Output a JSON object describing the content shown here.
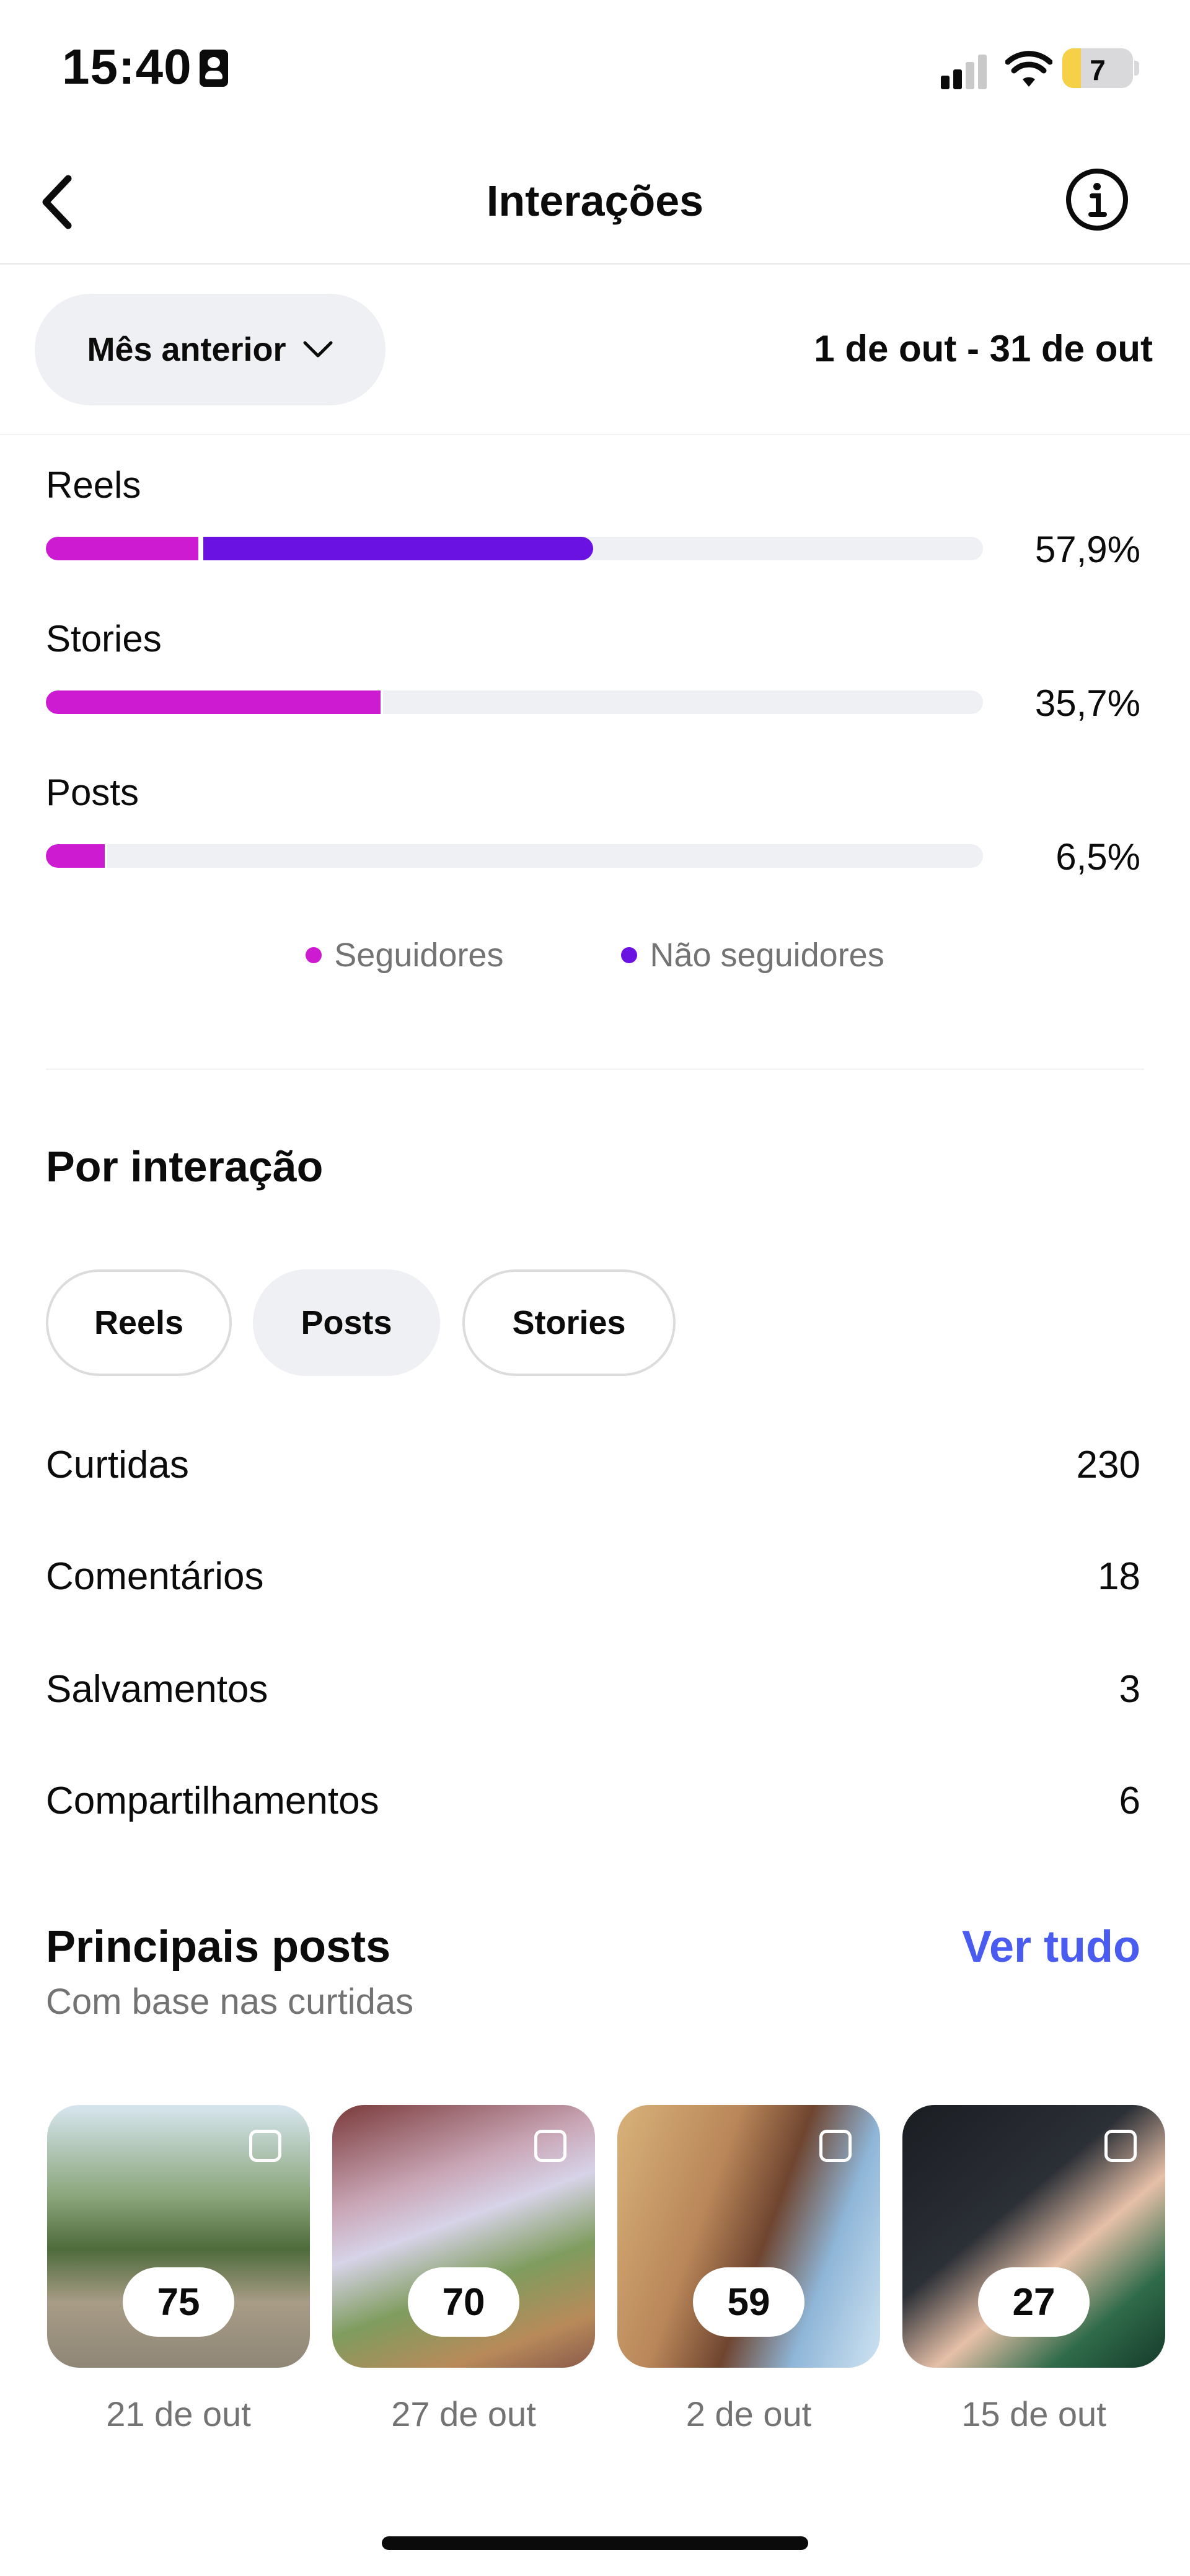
{
  "status_bar": {
    "time": "15:40",
    "battery": "7"
  },
  "header": {
    "title": "Interações"
  },
  "period": {
    "selected": "Mês anterior",
    "range": "1 de out - 31 de out"
  },
  "content_type_breakdown": [
    {
      "label": "Reels",
      "percent_text": "57,9%",
      "followers_fraction": 0.163,
      "non_followers_fraction": 0.416
    },
    {
      "label": "Stories",
      "percent_text": "35,7%",
      "followers_fraction": 0.357,
      "non_followers_fraction": 0.0
    },
    {
      "label": "Posts",
      "percent_text": "6,5%",
      "followers_fraction": 0.063,
      "non_followers_fraction": 0.0
    }
  ],
  "legend": {
    "followers": "Seguidores",
    "non_followers": "Não seguidores"
  },
  "colors": {
    "followers": "#cc1bd0",
    "non_followers": "#6a12e2",
    "link": "#4a5cf0"
  },
  "by_interaction": {
    "title": "Por interação",
    "tabs": [
      {
        "label": "Reels"
      },
      {
        "label": "Posts"
      },
      {
        "label": "Stories"
      }
    ],
    "selected_tab": "Posts",
    "metrics": [
      {
        "label": "Curtidas",
        "value": "230"
      },
      {
        "label": "Comentários",
        "value": "18"
      },
      {
        "label": "Salvamentos",
        "value": "3"
      },
      {
        "label": "Compartilhamentos",
        "value": "6"
      }
    ]
  },
  "top_posts": {
    "title": "Principais posts",
    "subtitle": "Com base nas curtidas",
    "see_all": "Ver tudo",
    "items": [
      {
        "count": "75",
        "date": "21 de out"
      },
      {
        "count": "70",
        "date": "27 de out"
      },
      {
        "count": "59",
        "date": "2 de out"
      },
      {
        "count": "27",
        "date": "15 de out"
      }
    ]
  }
}
